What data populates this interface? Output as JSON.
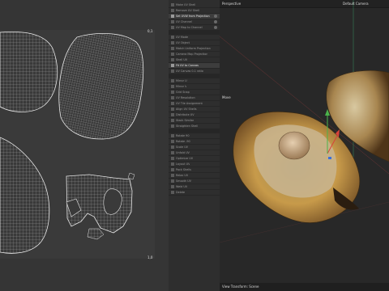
{
  "uv_editor": {
    "corner_top_right": "0,1",
    "corner_bottom_right": "1,0"
  },
  "tools": {
    "items": [
      {
        "label": "Make UV Shell",
        "highlight": false,
        "toggle": false
      },
      {
        "label": "Remove UV Shell",
        "highlight": false,
        "toggle": false
      },
      {
        "label": "Set UVW from Projection",
        "highlight": true,
        "toggle": true
      },
      {
        "label": "UV Channel",
        "highlight": false,
        "toggle": true
      },
      {
        "label": "UV Map to Channel",
        "highlight": false,
        "toggle": true
      },
      {
        "label": "UV Mode",
        "highlight": false,
        "toggle": false
      },
      {
        "label": "UV Object",
        "highlight": false,
        "toggle": false
      },
      {
        "label": "Match Uniform Projection",
        "highlight": false,
        "toggle": false
      },
      {
        "label": "Camera Map Projection",
        "highlight": false,
        "toggle": false
      },
      {
        "label": "Shell UV",
        "highlight": false,
        "toggle": false
      },
      {
        "label": "Fit UV to Canvas",
        "highlight": true,
        "toggle": false
      },
      {
        "label": "UV Canvas 0-1 ratio",
        "highlight": false,
        "toggle": false
      },
      {
        "label": "Mirror U",
        "highlight": false,
        "toggle": false
      },
      {
        "label": "Mirror V",
        "highlight": false,
        "toggle": false
      },
      {
        "label": "Grid Snap",
        "highlight": false,
        "toggle": false
      },
      {
        "label": "UV Resolution",
        "highlight": false,
        "toggle": false
      },
      {
        "label": "UV Tile Assignment",
        "highlight": false,
        "toggle": false
      },
      {
        "label": "Align UV Shells",
        "highlight": false,
        "toggle": false
      },
      {
        "label": "Distribute UV",
        "highlight": false,
        "toggle": false
      },
      {
        "label": "Stack Similar",
        "highlight": false,
        "toggle": false
      },
      {
        "label": "Straighten Shell",
        "highlight": false,
        "toggle": false
      },
      {
        "label": "Rotate 90",
        "highlight": false,
        "toggle": false
      },
      {
        "label": "Rotate -90",
        "highlight": false,
        "toggle": false
      },
      {
        "label": "Scale UV",
        "highlight": false,
        "toggle": false
      },
      {
        "label": "Unfold UV",
        "highlight": false,
        "toggle": false
      },
      {
        "label": "Optimize UV",
        "highlight": false,
        "toggle": false
      },
      {
        "label": "Layout UV",
        "highlight": false,
        "toggle": false
      },
      {
        "label": "Pack Shells",
        "highlight": false,
        "toggle": false
      },
      {
        "label": "Relax UV",
        "highlight": false,
        "toggle": false
      },
      {
        "label": "Smooth UV",
        "highlight": false,
        "toggle": false
      },
      {
        "label": "Weld UV",
        "highlight": false,
        "toggle": false
      },
      {
        "label": "Delete",
        "highlight": false,
        "toggle": false
      }
    ]
  },
  "viewport": {
    "view_name": "Perspective",
    "camera_name": "Default Camera",
    "gizmo_label": "Move",
    "status_text": "View Transform: Scene",
    "colors": {
      "axis_x": "#d9423a",
      "axis_y": "#4bb34b",
      "axis_z": "#3b6fd9"
    }
  }
}
